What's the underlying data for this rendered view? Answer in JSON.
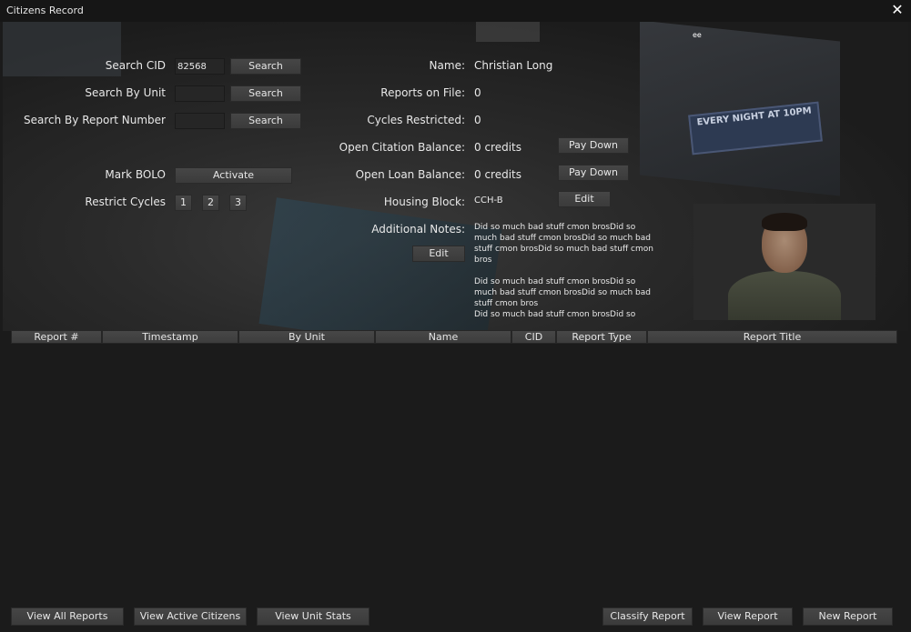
{
  "window": {
    "title": "Citizens Record"
  },
  "scene": {
    "sign_text": "EVERY NIGHT AT 10PM",
    "corner_text": "ee"
  },
  "search": {
    "cid_label": "Search CID",
    "cid_value": "82568",
    "unit_label": "Search By Unit",
    "unit_value": "",
    "report_label": "Search By Report Number",
    "report_value": "",
    "search_button": "Search"
  },
  "bolo": {
    "label": "Mark BOLO",
    "button": "Activate"
  },
  "restrict": {
    "label": "Restrict Cycles",
    "options": [
      "1",
      "2",
      "3"
    ]
  },
  "profile": {
    "name_label": "Name:",
    "name": "Christian Long",
    "reports_label": "Reports on File:",
    "reports": "0",
    "cycles_label": "Cycles Restricted:",
    "cycles": "0",
    "citation_label": "Open Citation Balance:",
    "citation": "0 credits",
    "loan_label": "Open Loan Balance:",
    "loan": "0 credits",
    "housing_label": "Housing Block:",
    "housing": "CCH-B",
    "notes_label": "Additional Notes:",
    "notes": "Did so much bad stuff cmon brosDid so much bad stuff cmon brosDid so much bad stuff cmon brosDid so much bad stuff cmon bros\n\nDid so much bad stuff cmon brosDid so much bad stuff cmon brosDid so much bad stuff cmon bros\nDid so much bad stuff cmon brosDid so",
    "pay_down": "Pay Down",
    "edit": "Edit"
  },
  "table": {
    "columns": [
      "Report #",
      "Timestamp",
      "By Unit",
      "Name",
      "CID",
      "Report Type",
      "Report Title"
    ],
    "rows": []
  },
  "footer": {
    "view_all_reports": "View All Reports",
    "view_active_citizens": "View Active Citizens",
    "view_unit_stats": "View Unit Stats",
    "classify_report": "Classify Report",
    "view_report": "View Report",
    "new_report": "New Report"
  }
}
